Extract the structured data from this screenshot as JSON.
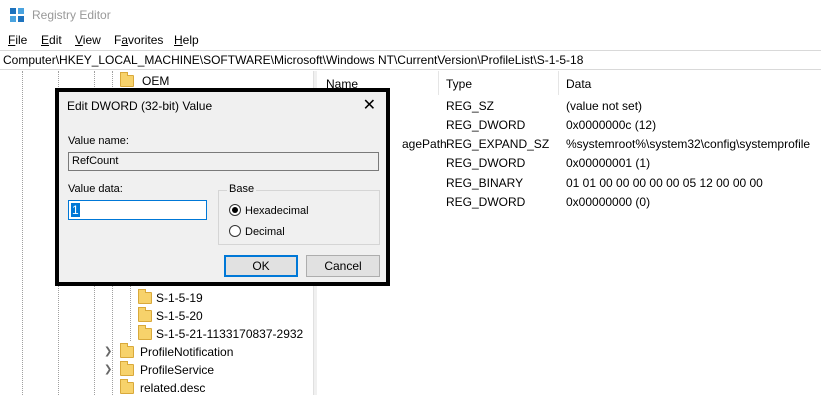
{
  "window": {
    "title": "Registry Editor"
  },
  "menu": [
    {
      "label": "File",
      "key": "F",
      "rest": "ile"
    },
    {
      "label": "Edit",
      "key": "E",
      "rest": "dit"
    },
    {
      "label": "View",
      "key": "V",
      "rest": "iew"
    },
    {
      "label": "Favorites",
      "key": "a",
      "pre": "F",
      "rest": "vorites"
    },
    {
      "label": "Help",
      "key": "H",
      "rest": "elp"
    }
  ],
  "address": "Computer\\HKEY_LOCAL_MACHINE\\SOFTWARE\\Microsoft\\Windows NT\\CurrentVersion\\ProfileList\\S-1-5-18",
  "tree": {
    "top_item": "OEM",
    "items": [
      {
        "label": "S-1-5-19"
      },
      {
        "label": "S-1-5-20"
      },
      {
        "label": "S-1-5-21-1133170837-2932"
      },
      {
        "label": "ProfileNotification"
      },
      {
        "label": "ProfileService"
      },
      {
        "label": "related.desc"
      }
    ]
  },
  "list": {
    "headers": {
      "name": "Name",
      "type": "Type",
      "data": "Data"
    },
    "partial_name": "agePath",
    "rows": [
      {
        "type": "REG_SZ",
        "data": "(value not set)"
      },
      {
        "type": "REG_DWORD",
        "data": "0x0000000c (12)"
      },
      {
        "type": "REG_EXPAND_SZ",
        "data": "%systemroot%\\system32\\config\\systemprofile"
      },
      {
        "type": "REG_DWORD",
        "data": "0x00000001 (1)"
      },
      {
        "type": "REG_BINARY",
        "data": "01 01 00 00 00 00 00 05 12 00 00 00"
      },
      {
        "type": "REG_DWORD",
        "data": "0x00000000 (0)"
      }
    ]
  },
  "dialog": {
    "title": "Edit DWORD (32-bit) Value",
    "close": "✕",
    "value_name_label": "Value name:",
    "value_name": "RefCount",
    "value_data_label": "Value data:",
    "value_data": "1",
    "base_label": "Base",
    "hex_label": "Hexadecimal",
    "dec_label": "Decimal",
    "base_selected": "Hexadecimal",
    "ok": "OK",
    "cancel": "Cancel"
  },
  "colors": {
    "accent": "#0078d7",
    "folder": "#f7d26b"
  }
}
